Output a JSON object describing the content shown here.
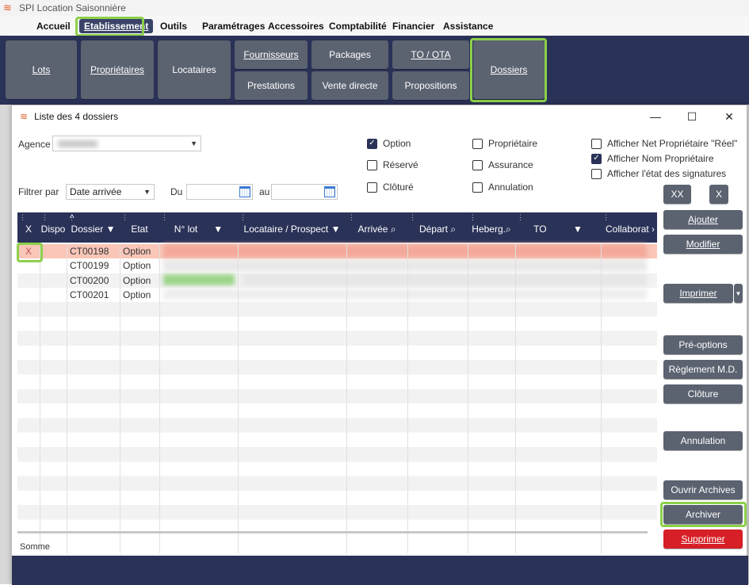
{
  "app": {
    "title": "SPI Location Saisonnière"
  },
  "menu": {
    "items": [
      "Accueil",
      "Etablissement",
      "Outils",
      "Paramétrages",
      "Accessoires",
      "Comptabilité",
      "Financier",
      "Assistance"
    ],
    "active": "Etablissement"
  },
  "ribbon": {
    "lots": "Lots",
    "proprietaires": "Propriétaires",
    "locataires": "Locataires",
    "fournisseurs": "Fournisseurs",
    "prestations": "Prestations",
    "packages": "Packages",
    "vente_directe": "Vente directe",
    "to_ota": "TO / OTA",
    "propositions": "Propositions",
    "dossiers": "Dossiers"
  },
  "window": {
    "title": "Liste des 4 dossiers",
    "controls": {
      "minimize": "—",
      "maximize": "☐",
      "close": "✕"
    }
  },
  "filters": {
    "agence_label": "Agence",
    "filtrer_par_label": "Filtrer par",
    "filtrer_par_value": "Date arrivée",
    "du_label": "Du",
    "au_label": "au"
  },
  "checkboxes": {
    "option": {
      "label": "Option",
      "checked": true
    },
    "reserve": {
      "label": "Réservé",
      "checked": false
    },
    "cloture": {
      "label": "Clôturé",
      "checked": false
    },
    "proprietaire": {
      "label": "Propriétaire",
      "checked": false
    },
    "assurance": {
      "label": "Assurance",
      "checked": false
    },
    "annulation": {
      "label": "Annulation",
      "checked": false
    },
    "net_proprio": {
      "label": "Afficher Net Propriétaire \"Réel\"",
      "checked": false
    },
    "nom_proprio": {
      "label": "Afficher Nom Propriétaire",
      "checked": true
    },
    "etat_signatures": {
      "label": "Afficher l'état des signatures",
      "checked": false
    }
  },
  "grid": {
    "columns": [
      "X",
      "Dispo",
      "Dossier",
      "Etat",
      "N° lot",
      "Locataire / Prospect",
      "Arrivée",
      "Départ",
      "Heberg.",
      "TO",
      "Collaborat"
    ],
    "rows": [
      {
        "x": "X",
        "dossier": "CT00198",
        "etat": "Option"
      },
      {
        "x": "",
        "dossier": "CT00199",
        "etat": "Option"
      },
      {
        "x": "",
        "dossier": "CT00200",
        "etat": "Option"
      },
      {
        "x": "",
        "dossier": "CT00201",
        "etat": "Option"
      }
    ],
    "somme_label": "Somme"
  },
  "side_buttons": {
    "xx": "XX",
    "x": "X",
    "ajouter": "Ajouter",
    "modifier": "Modifier",
    "imprimer": "Imprimer",
    "pre_options": "Pré-options",
    "reglement_md": "Règlement M.D.",
    "cloture": "Clôture",
    "annulation": "Annulation",
    "ouvrir_archives": "Ouvrir Archives",
    "archiver": "Archiver",
    "supprimer": "Supprimer"
  },
  "colors": {
    "navy": "#2a3258",
    "button": "#5b6270",
    "danger": "#d61f26",
    "highlight": "#8dd04a",
    "selected_row": "#f9c6b8"
  }
}
